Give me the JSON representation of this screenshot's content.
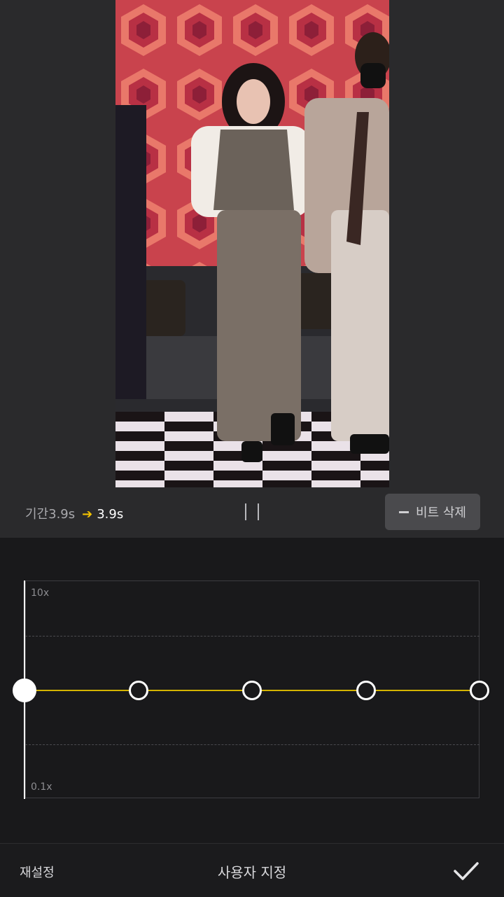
{
  "info": {
    "duration_label": "기간3.9s",
    "arrow": "➔",
    "new_duration": "3.9s",
    "delete_beat_label": "비트 삭제"
  },
  "graph": {
    "max_label": "10x",
    "min_label": "0.1x",
    "points": 5,
    "active_point": 0
  },
  "bottom": {
    "reset_label": "재설정",
    "title": "사용자 지정"
  },
  "icons": [
    "pause-icon",
    "minus-icon",
    "check-icon"
  ],
  "colors": {
    "accent": "#d4b400",
    "background": "#19191b"
  }
}
